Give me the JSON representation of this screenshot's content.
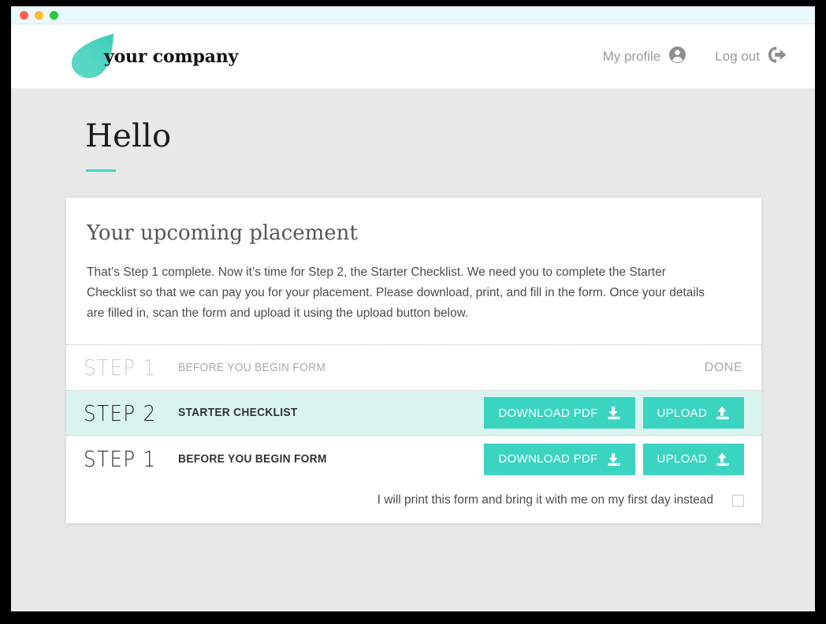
{
  "window": {
    "traffic_lights": [
      {
        "name": "close",
        "color": "#ff5f57"
      },
      {
        "name": "minimize",
        "color": "#febc2e"
      },
      {
        "name": "maximize",
        "color": "#28c840"
      }
    ]
  },
  "header": {
    "brand_name": "your company",
    "logo_icon": "teardrop-logo",
    "nav": [
      {
        "label": "My profile",
        "icon": "user-circle-icon"
      },
      {
        "label": "Log out",
        "icon": "logout-arrow-icon"
      }
    ]
  },
  "page": {
    "title": "Hello"
  },
  "card": {
    "title": "Your upcoming placement",
    "body": "That’s Step 1 complete. Now it’s time for Step 2, the Starter Checklist. We need you to complete the Starter Checklist so that we can pay you for your placement. Please download, print, and fill in the form. Once your details are filled in, scan the form and upload it using the upload button below.",
    "steps": [
      {
        "number": "STEP 1",
        "label": "BEFORE YOU BEGIN FORM",
        "state": "done",
        "status": "DONE",
        "highlighted": false
      },
      {
        "number": "STEP 2",
        "label": "STARTER CHECKLIST",
        "state": "active",
        "highlighted": true,
        "actions": [
          {
            "label": "DOWNLOAD PDF",
            "icon": "download-icon"
          },
          {
            "label": "UPLOAD",
            "icon": "upload-icon"
          }
        ]
      },
      {
        "number": "STEP 1",
        "label": "BEFORE YOU BEGIN FORM",
        "state": "pending",
        "highlighted": false,
        "actions": [
          {
            "label": "DOWNLOAD PDF",
            "icon": "download-icon"
          },
          {
            "label": "UPLOAD",
            "icon": "upload-icon"
          }
        ]
      }
    ],
    "checkbox": {
      "label": "I will print this form and bring it with me on my first day instead",
      "checked": false
    }
  },
  "colors": {
    "accent_teal": "#3ad4c0",
    "highlight_row": "#d9f4ef",
    "title_rule": "#45d5c4",
    "page_background": "#e8e8e8",
    "titlebar": "#eaf7fb"
  }
}
